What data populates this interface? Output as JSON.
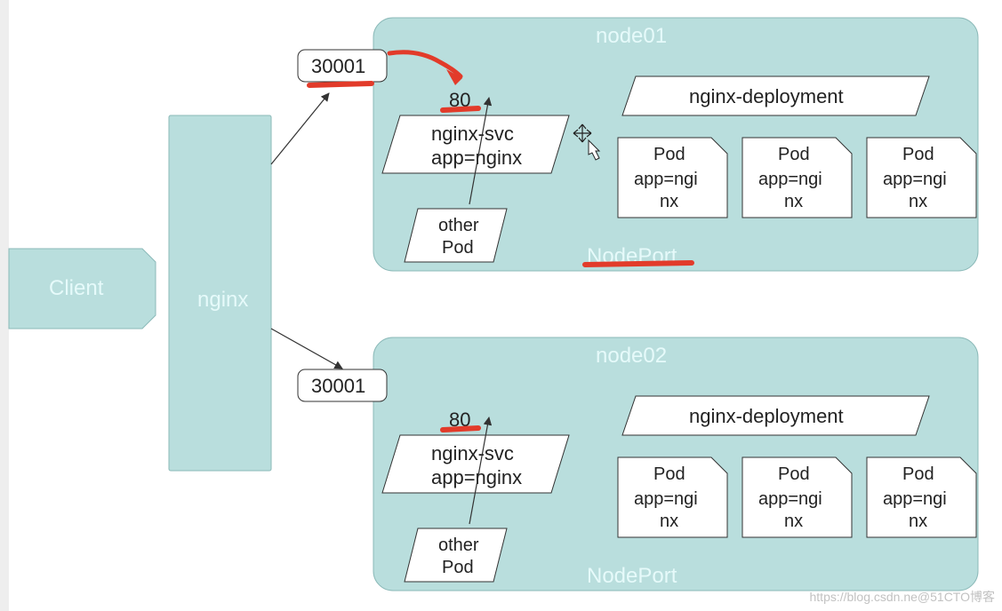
{
  "client": {
    "label": "Client"
  },
  "nginx": {
    "label": "nginx"
  },
  "nodes": [
    {
      "title": "node01",
      "nodeport_label": "NodePort",
      "port_box": "30001",
      "svc_port": "80",
      "svc_line1": "nginx-svc",
      "svc_line2": "app=nginx",
      "other_pod_line1": "other",
      "other_pod_line2": "Pod",
      "deployment": "nginx-deployment",
      "pods": [
        {
          "l1": "Pod",
          "l2": "app=ngi",
          "l3": "nx"
        },
        {
          "l1": "Pod",
          "l2": "app=ngi",
          "l3": "nx"
        },
        {
          "l1": "Pod",
          "l2": "app=ngi",
          "l3": "nx"
        }
      ]
    },
    {
      "title": "node02",
      "nodeport_label": "NodePort",
      "port_box": "30001",
      "svc_port": "80",
      "svc_line1": "nginx-svc",
      "svc_line2": "app=nginx",
      "other_pod_line1": "other",
      "other_pod_line2": "Pod",
      "deployment": "nginx-deployment",
      "pods": [
        {
          "l1": "Pod",
          "l2": "app=ngi",
          "l3": "nx"
        },
        {
          "l1": "Pod",
          "l2": "app=ngi",
          "l3": "nx"
        },
        {
          "l1": "Pod",
          "l2": "app=ngi",
          "l3": "nx"
        }
      ]
    }
  ],
  "watermark": "https://blog.csdn.ne@51CTO博客"
}
